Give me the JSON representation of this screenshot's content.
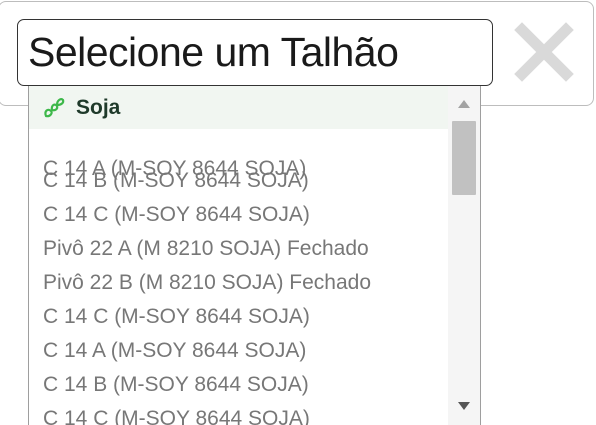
{
  "select": {
    "placeholder": "Selecione um Talhão"
  },
  "close": {
    "icon": "close-icon"
  },
  "dropdown": {
    "group": {
      "label": "Soja",
      "icon": "leaf-chain-icon",
      "icon_color": "#3db84a"
    },
    "options": [
      "C 14 A (M-SOY 8644 SOJA)",
      "C 14 B (M-SOY 8644 SOJA)",
      "C 14 C (M-SOY 8644 SOJA)",
      "Pivô 22 A (M 8210 SOJA) Fechado",
      "Pivô 22 B (M 8210 SOJA) Fechado",
      "C 14 C (M-SOY 8644 SOJA)",
      "C 14 A (M-SOY 8644 SOJA)",
      "C 14 B (M-SOY 8644 SOJA)",
      "C 14 C (M-SOY 8644 SOJA)"
    ]
  },
  "colors": {
    "option_text": "#777777",
    "group_background": "#f1f6f1",
    "close_icon": "#d9d9d9"
  }
}
